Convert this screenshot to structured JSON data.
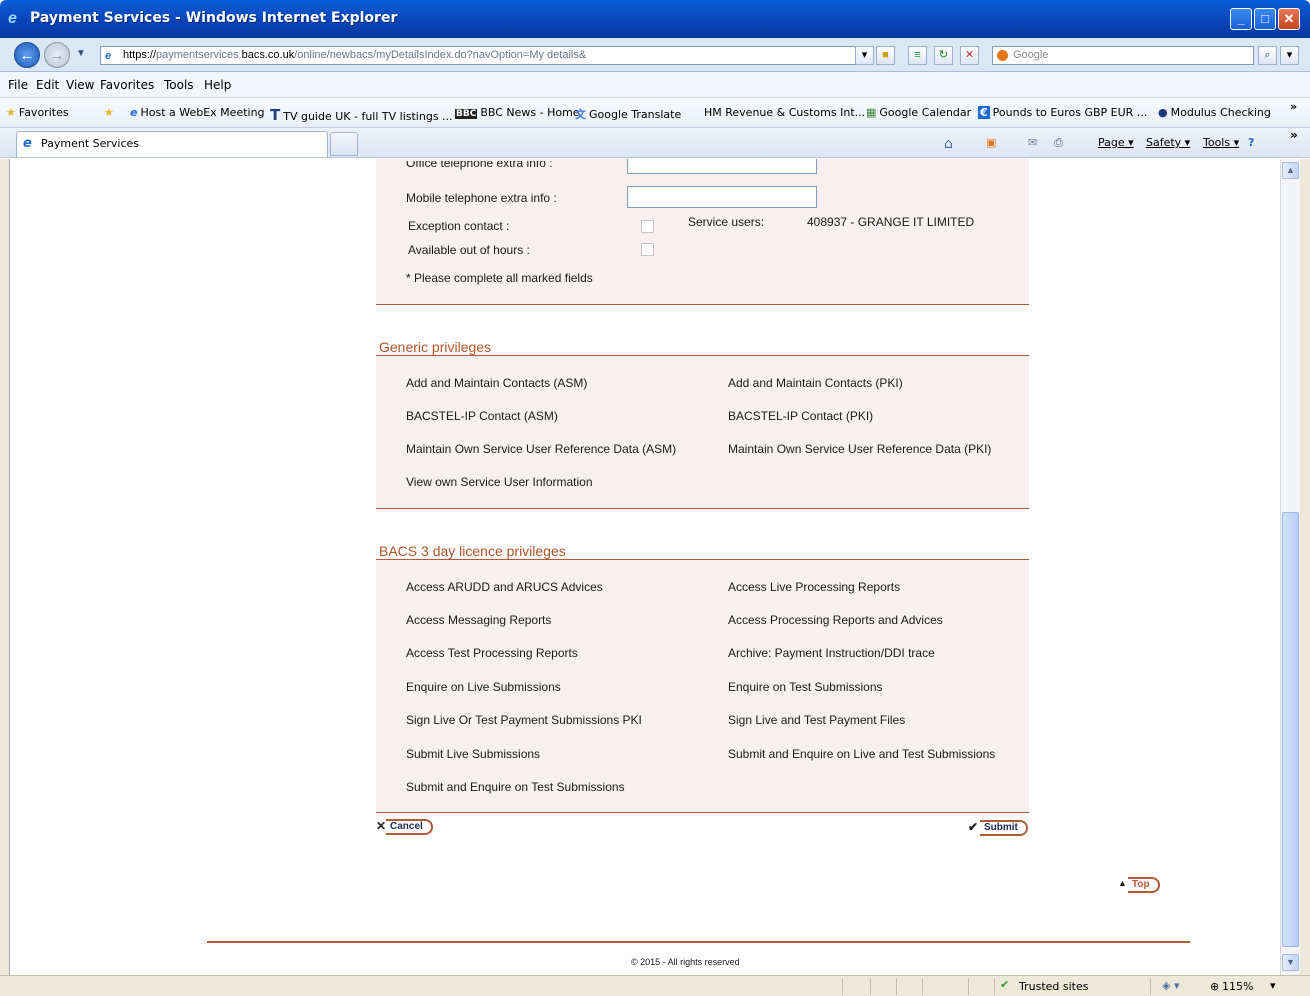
{
  "window": {
    "title": "Payment Services - Windows Internet Explorer"
  },
  "address": {
    "scheme": "https://",
    "pre_host": "paymentservices.",
    "host": "bacs.co.uk",
    "path": "/online/newbacs/myDetailsIndex.do?navOption=My details&",
    "search_placeholder": "Google"
  },
  "menu": [
    "File",
    "Edit",
    "View",
    "Favorites",
    "Tools",
    "Help"
  ],
  "favorites": {
    "label": "Favorites",
    "items": [
      "Host a WebEx Meeting",
      "TV guide UK - full TV listings ...",
      "BBC News - Home",
      "Google Translate",
      "HM Revenue & Customs Int...",
      "Google Calendar",
      "Pounds to Euros GBP EUR ...",
      "Modulus Checking"
    ]
  },
  "tab": {
    "title": "Payment Services"
  },
  "commands": [
    "Page ▾",
    "Safety ▾",
    "Tools ▾"
  ],
  "form": {
    "office_ext_label": "Office telephone extra info :",
    "mobile_ext_label": "Mobile telephone extra info :",
    "exception_label": "Exception contact :",
    "out_of_hours_label": "Available out of hours :",
    "service_users_label": "Service users:",
    "service_users_value": "408937 - GRANGE IT LIMITED",
    "required_note": "* Please complete all marked fields"
  },
  "generic": {
    "title": "Generic privileges",
    "left": [
      "Add and Maintain Contacts (ASM)",
      "BACSTEL-IP Contact (ASM)",
      "Maintain Own Service User Reference Data (ASM)",
      "View own Service User Information"
    ],
    "right": [
      "Add and Maintain Contacts (PKI)",
      "BACSTEL-IP Contact (PKI)",
      "Maintain Own Service User Reference Data (PKI)"
    ]
  },
  "bacs": {
    "title": "BACS 3 day licence privileges",
    "left": [
      "Access ARUDD and ARUCS Advices",
      "Access Messaging Reports",
      "Access Test Processing Reports",
      "Enquire on Live Submissions",
      "Sign Live Or Test Payment Submissions PKI",
      "Submit Live Submissions",
      "Submit and Enquire on Test Submissions"
    ],
    "right": [
      "Access Live Processing Reports",
      "Access Processing Reports and Advices",
      "Archive: Payment Instruction/DDI trace",
      "Enquire on Test Submissions",
      "Sign Live and Test Payment Files",
      "Submit and Enquire on Live and Test Submissions"
    ]
  },
  "buttons": {
    "cancel": "Cancel",
    "submit": "Submit",
    "top": "Top"
  },
  "footer": {
    "copyright": "© 2015 - All rights reserved"
  },
  "status": {
    "zone": "Trusted sites",
    "zoom": "115%"
  }
}
